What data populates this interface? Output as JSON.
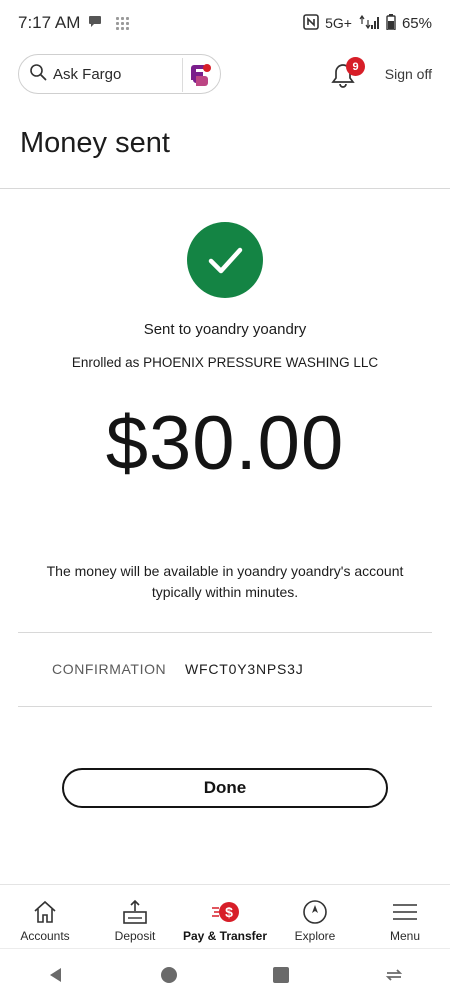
{
  "status_bar": {
    "time": "7:17 AM",
    "network": "5G+",
    "battery": "65%"
  },
  "header": {
    "search_label": "Ask Fargo",
    "notification_count": "9",
    "sign_off": "Sign off"
  },
  "page": {
    "title": "Money sent",
    "sent_to": "Sent to yoandry yoandry",
    "enrolled_as": "Enrolled as PHOENIX PRESSURE WASHING LLC",
    "amount": "$30.00",
    "availability_text": "The money will be available in yoandry yoandry's account typically within minutes.",
    "confirmation_label": "CONFIRMATION",
    "confirmation_value": "WFCT0Y3NPS3J",
    "done_label": "Done"
  },
  "bottom_nav": {
    "items": [
      {
        "label": "Accounts",
        "icon": "home-icon"
      },
      {
        "label": "Deposit",
        "icon": "deposit-icon"
      },
      {
        "label": "Pay & Transfer",
        "icon": "pay-transfer-icon",
        "active": true
      },
      {
        "label": "Explore",
        "icon": "compass-icon"
      },
      {
        "label": "Menu",
        "icon": "hamburger-icon"
      }
    ]
  },
  "colors": {
    "success_green": "#148444",
    "brand_red": "#d71e28",
    "fargo_purple": "#7a1e8c"
  }
}
